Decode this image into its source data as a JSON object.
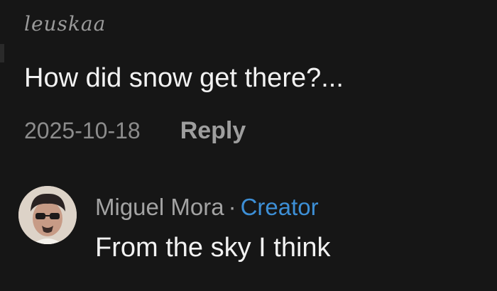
{
  "comment": {
    "username": "leuskaa",
    "text": "How did snow get there?...",
    "date": "2025-10-18",
    "reply_label": "Reply"
  },
  "reply": {
    "author": "Miguel  Mora",
    "separator": "·",
    "badge": "Creator",
    "text": "From the sky I think"
  },
  "colors": {
    "background": "#161616",
    "text": "#f2f2f2",
    "muted": "#8c8c8c",
    "creator_badge": "#3d8fd6"
  }
}
